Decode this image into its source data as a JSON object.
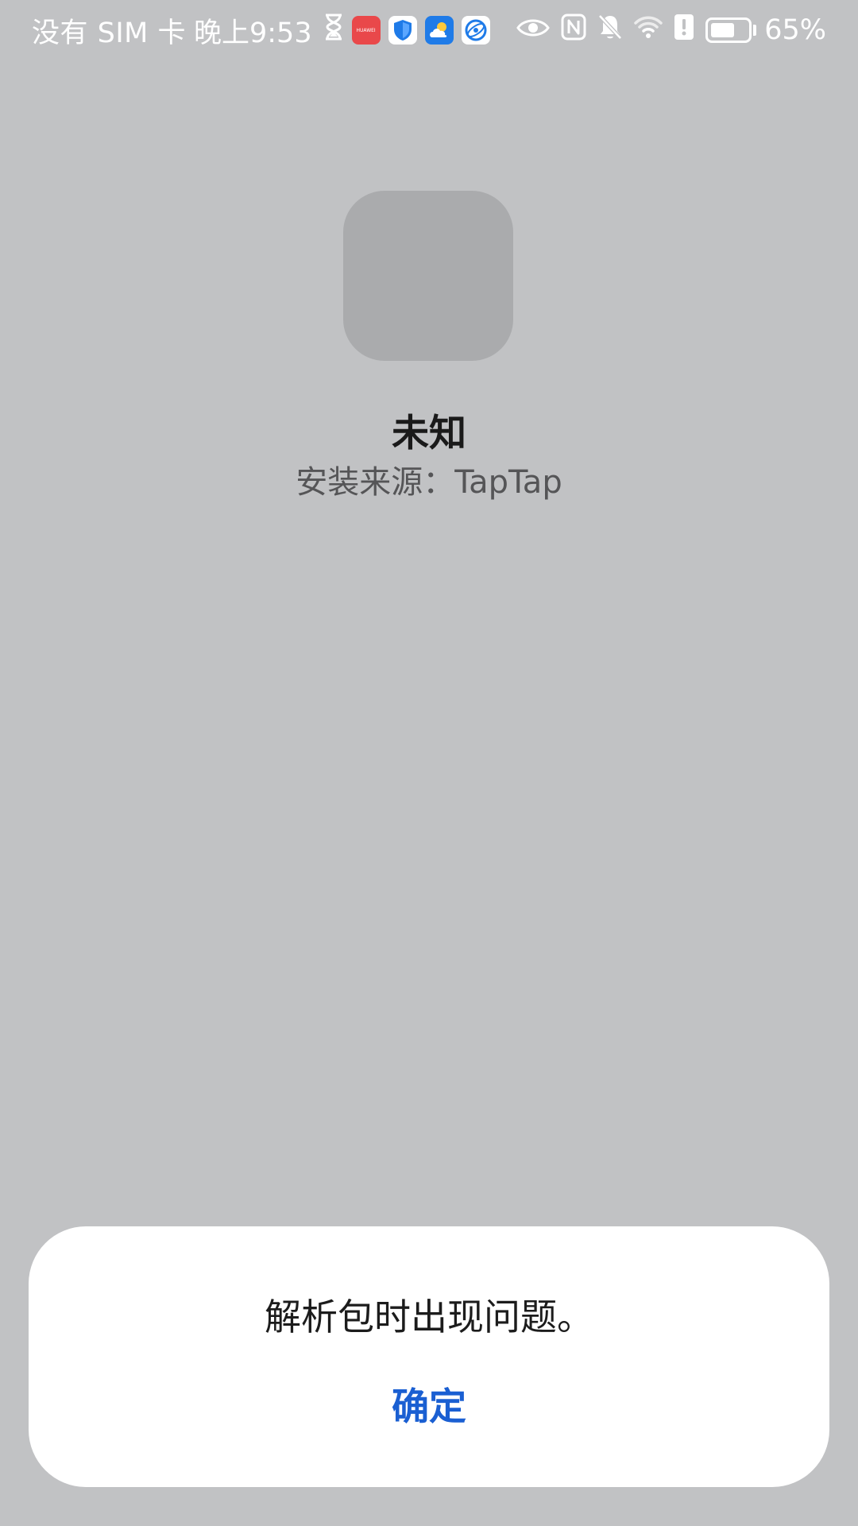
{
  "status_bar": {
    "carrier": "没有 SIM 卡",
    "time": "晚上9:53",
    "battery_percent_text": "65%",
    "battery_level": 0.65,
    "notification_icons": [
      "hourglass-icon",
      "huawei-appgallery-icon",
      "shield-icon",
      "weather-icon",
      "browser-icon"
    ],
    "system_icons": [
      "eye-icon",
      "nfc-icon",
      "bell-muted-icon",
      "wifi-icon",
      "alert-icon",
      "battery-icon"
    ],
    "huawei_label": "HUAWEI"
  },
  "app": {
    "name": "未知",
    "install_source": "安装来源：TapTap"
  },
  "dialog": {
    "message": "解析包时出现问题。",
    "confirm_label": "确定"
  },
  "colors": {
    "background": "#c1c2c4",
    "icon_placeholder": "#aaabad",
    "accent": "#1a5fd2",
    "dialog_background": "#ffffff"
  }
}
